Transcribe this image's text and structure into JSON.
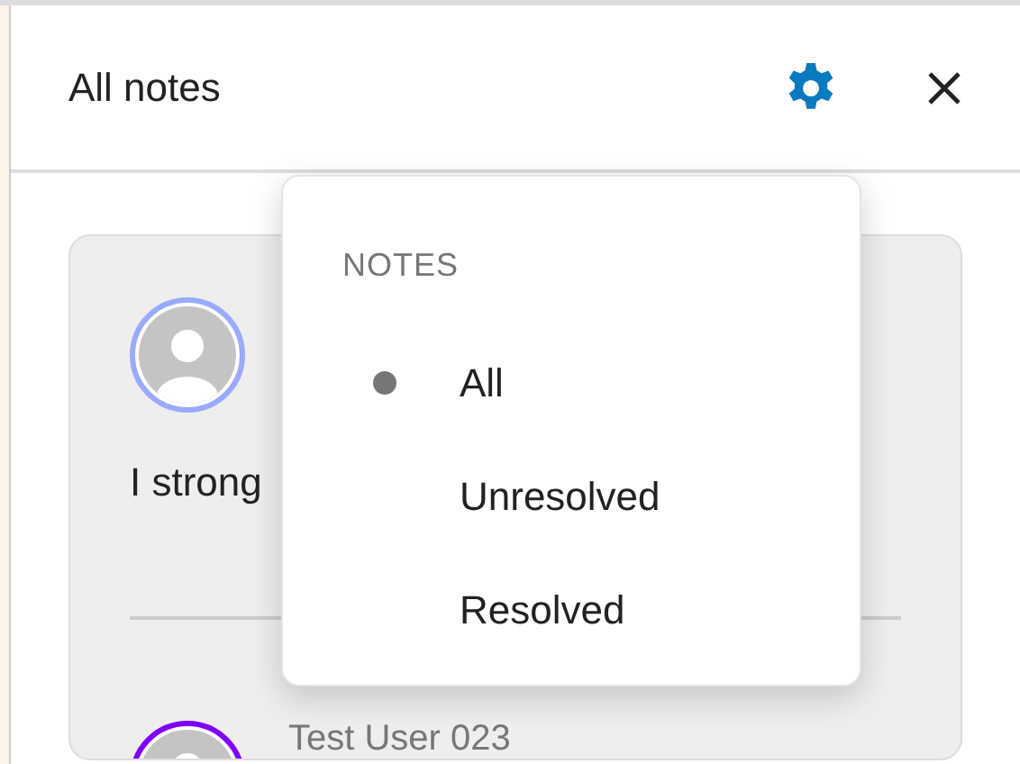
{
  "panel": {
    "title": "All notes"
  },
  "notes": [
    {
      "text": "I strong",
      "color": "#99aaff"
    },
    {
      "author": "Test User 023",
      "color": "#7f00ff"
    }
  ],
  "filter_menu": {
    "heading": "NOTES",
    "items": [
      {
        "label": "All",
        "selected": true
      },
      {
        "label": "Unresolved",
        "selected": false
      },
      {
        "label": "Resolved",
        "selected": false
      }
    ]
  }
}
